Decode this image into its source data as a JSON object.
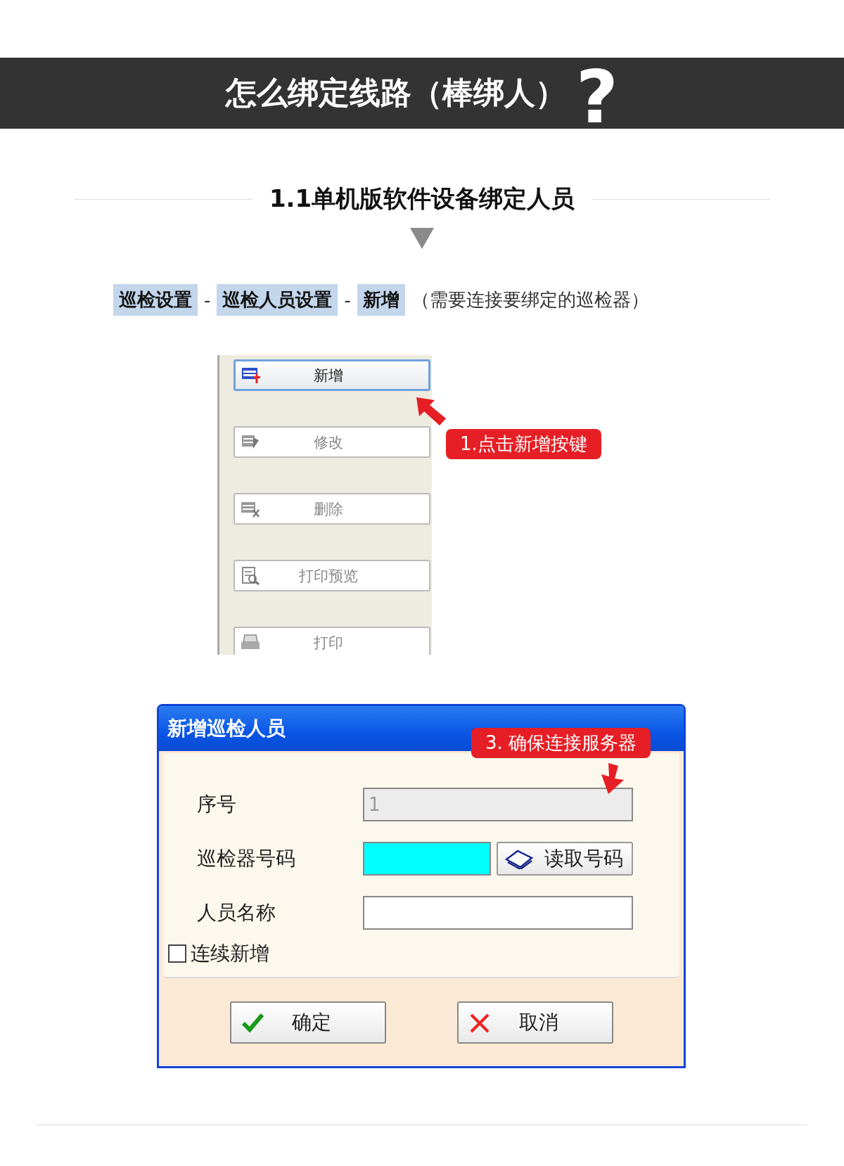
{
  "banner": {
    "title": "怎么绑定线路（棒绑人）",
    "mark": "?"
  },
  "section": {
    "heading": "1.1单机版软件设备绑定人员"
  },
  "path": [
    {
      "kind": "chip",
      "text": "巡检设置"
    },
    {
      "kind": "separator",
      "text": "-"
    },
    {
      "kind": "chip",
      "text": "巡检人员设置"
    },
    {
      "kind": "separator",
      "text": "-"
    },
    {
      "kind": "chip",
      "text": "新增"
    },
    {
      "kind": "note",
      "text": "（需要连接要绑定的巡检器）"
    }
  ],
  "toolbar_panel": {
    "callout": "1.点击新增按键",
    "buttons": [
      {
        "kind": "add",
        "label": "新增",
        "selected": true,
        "disabled": false
      },
      {
        "kind": "edit",
        "label": "修改",
        "selected": false,
        "disabled": true
      },
      {
        "kind": "delete",
        "label": "删除",
        "selected": false,
        "disabled": true
      },
      {
        "kind": "preview",
        "label": "打印预览",
        "selected": false,
        "disabled": true
      },
      {
        "kind": "print",
        "label": "打印",
        "selected": false,
        "disabled": true
      }
    ]
  },
  "dialog": {
    "title": "新增巡检人员",
    "callout": "3. 确保连接服务器",
    "fields": [
      {
        "label": "序号",
        "value": "1",
        "disabled": true,
        "highlighted": false
      },
      {
        "label": "巡检器号码",
        "disabled": false,
        "highlighted": true,
        "button": "读取号码"
      },
      {
        "label": "人员名称",
        "disabled": false,
        "highlighted": false
      }
    ],
    "checkbox": {
      "label": "连续新增",
      "checked": false
    },
    "buttons": [
      {
        "kind": "ok",
        "label": "确定"
      },
      {
        "kind": "cancel",
        "label": "取消"
      }
    ]
  }
}
